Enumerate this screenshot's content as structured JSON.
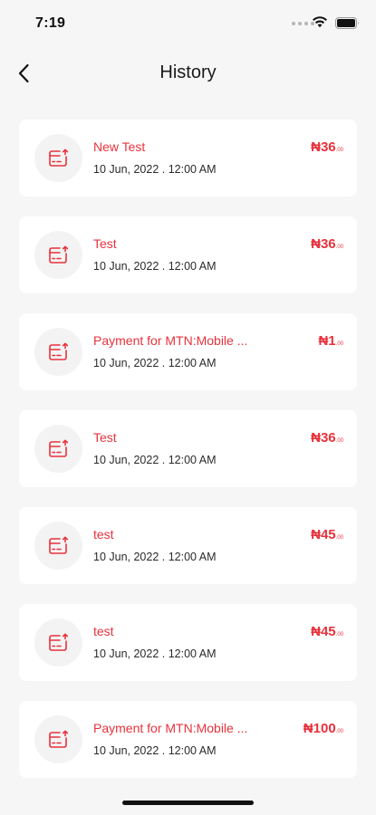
{
  "status_bar": {
    "time": "7:19"
  },
  "header": {
    "title": "History"
  },
  "colors": {
    "accent": "#e8323c",
    "icon_bg": "#f3f3f3",
    "background": "#f6f6f6"
  },
  "transactions": [
    {
      "title": "New Test",
      "date": "10 Jun, 2022 . 12:00 AM",
      "amount": "₦36",
      "amount_decimal": ".00",
      "icon": "receipt-icon"
    },
    {
      "title": "Test",
      "date": "10 Jun, 2022 . 12:00 AM",
      "amount": "₦36",
      "amount_decimal": ".00",
      "icon": "receipt-icon"
    },
    {
      "title": "Payment for MTN:Mobile ...",
      "date": "10 Jun, 2022 . 12:00 AM",
      "amount": "₦1",
      "amount_decimal": ".00",
      "icon": "receipt-icon"
    },
    {
      "title": "Test",
      "date": "10 Jun, 2022 . 12:00 AM",
      "amount": "₦36",
      "amount_decimal": ".00",
      "icon": "receipt-icon"
    },
    {
      "title": "test",
      "date": "10 Jun, 2022 . 12:00 AM",
      "amount": "₦45",
      "amount_decimal": ".00",
      "icon": "receipt-icon"
    },
    {
      "title": "test",
      "date": "10 Jun, 2022 . 12:00 AM",
      "amount": "₦45",
      "amount_decimal": ".00",
      "icon": "receipt-icon"
    },
    {
      "title": "Payment for MTN:Mobile ...",
      "date": "10 Jun, 2022 . 12:00 AM",
      "amount": "₦100",
      "amount_decimal": ".00",
      "icon": "receipt-icon"
    }
  ]
}
